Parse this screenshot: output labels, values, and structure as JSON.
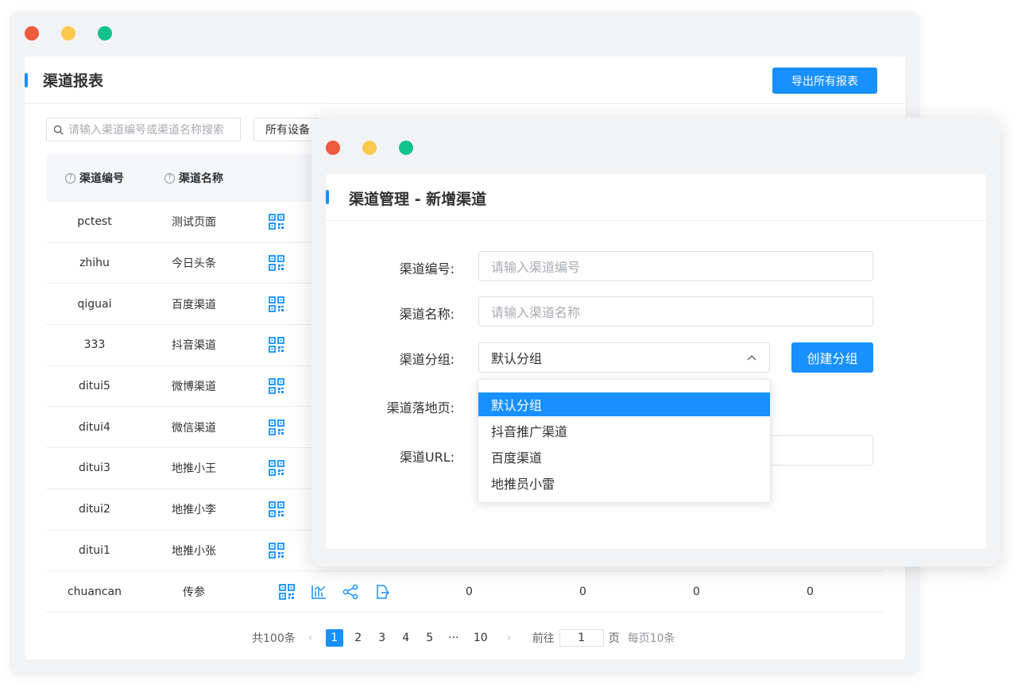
{
  "back": {
    "title": "渠道报表",
    "export_button": "导出所有报表",
    "search_placeholder": "请输入渠道编号或渠道名称搜索",
    "device_select": "所有设备",
    "headers": [
      "渠道编号",
      "渠道名称"
    ],
    "rows": [
      {
        "code": "pctest",
        "name": "测试页面"
      },
      {
        "code": "zhihu",
        "name": "今日头条"
      },
      {
        "code": "qiguai",
        "name": "百度渠道"
      },
      {
        "code": "333",
        "name": "抖音渠道"
      },
      {
        "code": "ditui5",
        "name": "微博渠道"
      },
      {
        "code": "ditui4",
        "name": "微信渠道"
      },
      {
        "code": "ditui3",
        "name": "地推小王"
      },
      {
        "code": "ditui2",
        "name": "地推小李"
      },
      {
        "code": "ditui1",
        "name": "地推小张"
      },
      {
        "code": "chuancan",
        "name": "传参",
        "values": [
          "0",
          "0",
          "0",
          "0"
        ]
      }
    ],
    "pagination": {
      "total": "共100条",
      "pages": [
        "1",
        "2",
        "3",
        "4",
        "5",
        "···",
        "10"
      ],
      "goto_label": "前往",
      "goto_value": "1",
      "page_unit": "页",
      "per_page": "每页10条"
    }
  },
  "front": {
    "title": "渠道管理 - 新增渠道",
    "labels": {
      "code": "渠道编号:",
      "name": "渠道名称:",
      "group": "渠道分组:",
      "landing": "渠道落地页:",
      "url": "渠道URL:"
    },
    "code_placeholder": "请输入渠道编号",
    "name_placeholder": "请输入渠道名称",
    "group_value": "默认分组",
    "create_group_button": "创建分组",
    "group_options": [
      "默认分组",
      "抖音推广渠道",
      "百度渠道",
      "地推员小雷"
    ]
  },
  "colors": {
    "primary": "#1890ff",
    "dot_red": "#f05a3c",
    "dot_yellow": "#fcc94e",
    "dot_green": "#12c28b"
  }
}
